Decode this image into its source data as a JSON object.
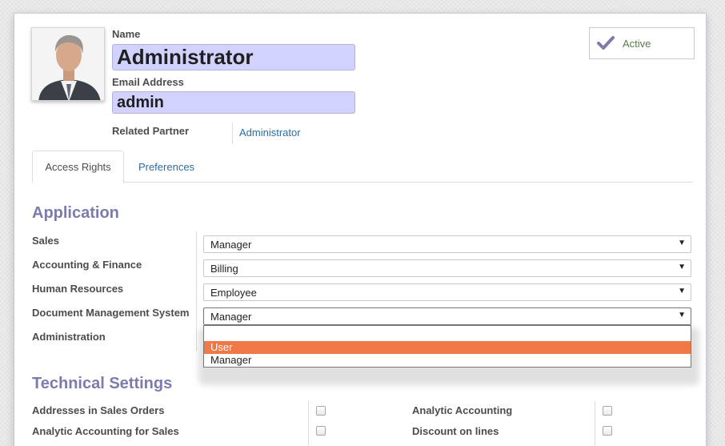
{
  "header": {
    "name_label": "Name",
    "name_value": "Administrator",
    "email_label": "Email Address",
    "email_value": "admin",
    "related_partner_label": "Related Partner",
    "related_partner_value": "Administrator",
    "active_label": "Active"
  },
  "tabs": [
    {
      "label": "Access Rights",
      "active": true
    },
    {
      "label": "Preferences",
      "active": false
    }
  ],
  "application": {
    "title": "Application",
    "rows": [
      {
        "label": "Sales",
        "value": "Manager"
      },
      {
        "label": "Accounting & Finance",
        "value": "Billing"
      },
      {
        "label": "Human Resources",
        "value": "Employee"
      },
      {
        "label": "Document Management System",
        "value": "Manager"
      },
      {
        "label": "Administration",
        "value": ""
      }
    ],
    "dropdown_options": [
      "",
      "User",
      "Manager"
    ],
    "dropdown_highlighted": "User"
  },
  "technical": {
    "title": "Technical Settings",
    "left": [
      {
        "label": "Addresses in Sales Orders",
        "checked": false
      },
      {
        "label": "Analytic Accounting for Sales",
        "checked": false
      }
    ],
    "right": [
      {
        "label": "Analytic Accounting",
        "checked": false
      },
      {
        "label": "Discount on lines",
        "checked": false
      }
    ]
  },
  "colors": {
    "accent": "#7c7bad",
    "link": "#2d6da4",
    "input_required": "#d2d2ff",
    "highlight": "#f07746"
  },
  "icons": {
    "active": "checkmark-icon",
    "dropdown": "triangle-down-icon"
  }
}
